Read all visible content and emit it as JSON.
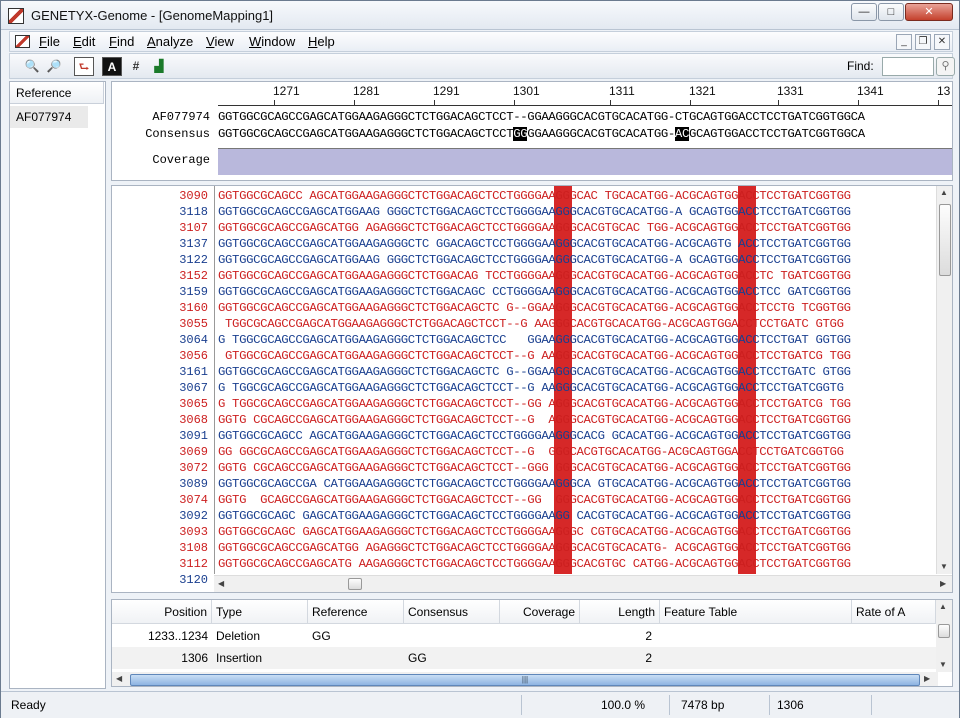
{
  "window": {
    "title": "GENETYX-Genome - [GenomeMapping1]"
  },
  "menu": [
    {
      "label": "File",
      "u": "F",
      "rest": "ile"
    },
    {
      "label": "Edit",
      "u": "E",
      "rest": "dit"
    },
    {
      "label": "Find",
      "u": "F",
      "rest": "ind"
    },
    {
      "label": "Analyze",
      "u": "A",
      "rest": "nalyze"
    },
    {
      "label": "View",
      "u": "V",
      "rest": "iew"
    },
    {
      "label": "Window",
      "u": "W",
      "rest": "indow"
    },
    {
      "label": "Help",
      "u": "H",
      "rest": "elp"
    }
  ],
  "toolbar": {
    "find_label": "Find:",
    "find_value": ""
  },
  "sidebar": {
    "header": "Reference",
    "items": [
      "AF077974"
    ]
  },
  "ruler": [
    "1271",
    "1281",
    "1291",
    "1301",
    "1311",
    "1321",
    "1331",
    "1341",
    "13"
  ],
  "alignment": {
    "reference_label": "AF077974",
    "reference_seq": "GGTGGCGCAGCCGAGCATGGAAGAGGGCTCTGGACAGCTCCT--GGAAGGGCACGTGCACATGG-CTGCAGTGGACCTCCTGATCGGTGGCA",
    "consensus_label": "Consensus",
    "consensus_pre": "GGTGGCGCAGCCGAGCATGGAAGAGGGCTCTGGACAGCTCCT",
    "consensus_hl1": "GG",
    "consensus_mid": "GGAAGGGCACGTGCACATGG-",
    "consensus_hl2": "AC",
    "consensus_post": "GCAGTGGACCTCCTGATCGGTGGCA",
    "coverage_label": "Coverage"
  },
  "reads": [
    {
      "id": "3090",
      "color": "red",
      "seq": "GGTGGCGCAGCC AGCATGGAAGAGGGCTCTGGACAGCTCCTGGGGAAGGGCAC TGCACATGG-ACGCAGTGGACCTCCTGATCGGTGG"
    },
    {
      "id": "3118",
      "color": "blue",
      "seq": "GGTGGCGCAGCCGAGCATGGAAG GGGCTCTGGACAGCTCCTGGGGAAGGGCACGTGCACATGG-A GCAGTGGACCTCCTGATCGGTGG"
    },
    {
      "id": "3107",
      "color": "red",
      "seq": "GGTGGCGCAGCCGAGCATGG AGAGGGCTCTGGACAGCTCCTGGGGAAGGGCACGTGCAC TGG-ACGCAGTGGACCTCCTGATCGGTGG"
    },
    {
      "id": "3137",
      "color": "blue",
      "seq": "GGTGGCGCAGCCGAGCATGGAAGAGGGCTC GGACAGCTCCTGGGGAAGGGCACGTGCACATGG-ACGCAGTG ACCTCCTGATCGGTGG"
    },
    {
      "id": "3122",
      "color": "blue",
      "seq": "GGTGGCGCAGCCGAGCATGGAAG GGGCTCTGGACAGCTCCTGGGGAAGGGCACGTGCACATGG-A GCAGTGGACCTCCTGATCGGTGG"
    },
    {
      "id": "3152",
      "color": "red",
      "seq": "GGTGGCGCAGCCGAGCATGGAAGAGGGCTCTGGACAG TCCTGGGGAAGGGCACGTGCACATGG-ACGCAGTGGACCTC TGATCGGTGG"
    },
    {
      "id": "3159",
      "color": "blue",
      "seq": "GGTGGCGCAGCCGAGCATGGAAGAGGGCTCTGGACAGC CCTGGGGAAGGGCACGTGCACATGG-ACGCAGTGGACCTCC GATCGGTGG"
    },
    {
      "id": "3160",
      "color": "red",
      "seq": "GGTGGCGCAGCCGAGCATGGAAGAGGGCTCTGGACAGCTC G--GGAAGGGCACGTGCACATGG-ACGCAGTGGACCTCCTG TCGGTGG"
    },
    {
      "id": "3055",
      "color": "red",
      "seq": " TGGCGCAGCCGAGCATGGAAGAGGGCTCTGGACAGCTCCT--G AAGGGCACGTGCACATGG-ACGCAGTGGACCTCCTGATC GTGG"
    },
    {
      "id": "3064",
      "color": "blue",
      "seq": "G TGGCGCAGCCGAGCATGGAAGAGGGCTCTGGACAGCTCC   GGAAGGGCACGTGCACATGG-ACGCAGTGGACCTCCTGAT GGTGG"
    },
    {
      "id": "3056",
      "color": "red",
      "seq": " GTGGCGCAGCCGAGCATGGAAGAGGGCTCTGGACAGCTCCT--G AAGGGCACGTGCACATGG-ACGCAGTGGACCTCCTGATCG TGG"
    },
    {
      "id": "3161",
      "color": "blue",
      "seq": "GGTGGCGCAGCCGAGCATGGAAGAGGGCTCTGGACAGCTC G--GGAAGGGCACGTGCACATGG-ACGCAGTGGACCTCCTGATC GTGG"
    },
    {
      "id": "3067",
      "color": "blue",
      "seq": "G TGGCGCAGCCGAGCATGGAAGAGGGCTCTGGACAGCTCCT--G AAGGGCACGTGCACATGG-ACGCAGTGGACCTCCTGATCGGTG"
    },
    {
      "id": "3065",
      "color": "red",
      "seq": "G TGGCGCAGCCGAGCATGGAAGAGGGCTCTGGACAGCTCCT--GG AGGGCACGTGCACATGG-ACGCAGTGGACCTCCTGATCG TGG"
    },
    {
      "id": "3068",
      "color": "red",
      "seq": "GGTG CGCAGCCGAGCATGGAAGAGGGCTCTGGACAGCTCCT--G  AGGGCACGTGCACATGG-ACGCAGTGGACCTCCTGATCGGTGG"
    },
    {
      "id": "3091",
      "color": "blue",
      "seq": "GGTGGCGCAGCC AGCATGGAAGAGGGCTCTGGACAGCTCCTGGGGAAGGGCACG GCACATGG-ACGCAGTGGACCTCCTGATCGGTGG"
    },
    {
      "id": "3069",
      "color": "red",
      "seq": "GG GGCGCAGCCGAGCATGGAAGAGGGCTCTGGACAGCTCCT--G  GGGCACGTGCACATGG-ACGCAGTGGACCTCCTGATCGGTGG"
    },
    {
      "id": "3072",
      "color": "red",
      "seq": "GGTG CGCAGCCGAGCATGGAAGAGGGCTCTGGACAGCTCCT--GGG GGGCACGTGCACATGG-ACGCAGTGGACCTCCTGATCGGTGG"
    },
    {
      "id": "3089",
      "color": "blue",
      "seq": "GGTGGCGCAGCCGA CATGGAAGAGGGCTCTGGACAGCTCCTGGGGAAGGGCA GTGCACATGG-ACGCAGTGGACCTCCTGATCGGTGG"
    },
    {
      "id": "3074",
      "color": "red",
      "seq": "GGTG  GCAGCCGAGCATGGAAGAGGGCTCTGGACAGCTCCT--GG  GGGCACGTGCACATGG-ACGCAGTGGACCTCCTGATCGGTGG"
    },
    {
      "id": "3092",
      "color": "blue",
      "seq": "GGTGGCGCAGC GAGCATGGAAGAGGGCTCTGGACAGCTCCTGGGGAAGG CACGTGCACATGG-ACGCAGTGGACCTCCTGATCGGTGG"
    },
    {
      "id": "3093",
      "color": "red",
      "seq": "GGTGGCGCAGC GAGCATGGAAGAGGGCTCTGGACAGCTCCTGGGGAAGGGC CGTGCACATGG-ACGCAGTGGACCTCCTGATCGGTGG"
    },
    {
      "id": "3108",
      "color": "red",
      "seq": "GGTGGCGCAGCCGAGCATGG AGAGGGCTCTGGACAGCTCCTGGGGAAGGGCACGTGCACATG- ACGCAGTGGACCTCCTGATCGGTGG"
    },
    {
      "id": "3112",
      "color": "red",
      "seq": "GGTGGCGCAGCCGAGCATG AAGAGGGCTCTGGACAGCTCCTGGGGAAGGGCACGTGC CATGG-ACGCAGTGGACCTCCTGATCGGTGG"
    },
    {
      "id": "3120",
      "color": "blue",
      "seq": ""
    }
  ],
  "table": {
    "headers": [
      "Position",
      "Type",
      "Reference",
      "Consensus",
      "Coverage",
      "Length",
      "Feature Table",
      "Rate of A"
    ],
    "rows": [
      {
        "position": "1233..1234",
        "type": "Deletion",
        "reference": "GG",
        "consensus": "",
        "coverage": "",
        "length": "2"
      },
      {
        "position": "1306",
        "type": "Insertion",
        "reference": "",
        "consensus": "GG",
        "coverage": "",
        "length": "2"
      }
    ]
  },
  "status": {
    "ready": "Ready",
    "percent": "100.0 %",
    "length": "7478 bp",
    "position": "1306"
  }
}
